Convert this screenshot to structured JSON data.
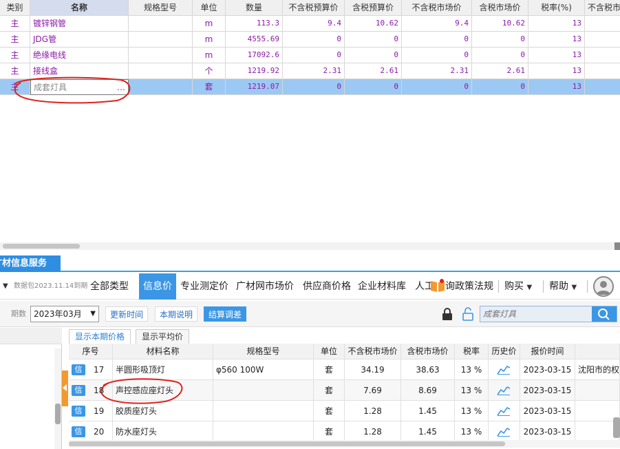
{
  "top_grid": {
    "columns": [
      {
        "key": "cat",
        "label": "类别",
        "width": 44,
        "active": false
      },
      {
        "key": "name",
        "label": "名称",
        "width": 143,
        "active": true
      },
      {
        "key": "spec",
        "label": "规格型号",
        "width": 93,
        "active": false
      },
      {
        "key": "unit",
        "label": "单位",
        "width": 48,
        "active": false
      },
      {
        "key": "qty",
        "label": "数量",
        "width": 83,
        "active": false
      },
      {
        "key": "p1",
        "label": "不含税预算价",
        "width": 90,
        "active": false
      },
      {
        "key": "p2",
        "label": "含税预算价",
        "width": 83,
        "active": false
      },
      {
        "key": "p3",
        "label": "不含税市场价",
        "width": 102,
        "active": false
      },
      {
        "key": "p4",
        "label": "含税市场价",
        "width": 82,
        "active": false
      },
      {
        "key": "tax",
        "label": "税率(%)",
        "width": 82,
        "active": false
      },
      {
        "key": "p5",
        "label": "不含税市",
        "width": 55,
        "active": false
      }
    ],
    "rows": [
      {
        "cat": "主",
        "name": "镀锌钢管",
        "spec": "",
        "unit": "m",
        "qty": "113.3",
        "p1": "9.4",
        "p2": "10.62",
        "p3": "9.4",
        "p4": "10.62",
        "tax": "13",
        "p5": ""
      },
      {
        "cat": "主",
        "name": "JDG管",
        "spec": "",
        "unit": "m",
        "qty": "4555.69",
        "p1": "0",
        "p2": "0",
        "p3": "0",
        "p4": "0",
        "tax": "13",
        "p5": ""
      },
      {
        "cat": "主",
        "name": "绝缘电线",
        "spec": "",
        "unit": "m",
        "qty": "17092.6",
        "p1": "0",
        "p2": "0",
        "p3": "0",
        "p4": "0",
        "tax": "13",
        "p5": ""
      },
      {
        "cat": "主",
        "name": "接线盒",
        "spec": "",
        "unit": "个",
        "qty": "1219.92",
        "p1": "2.31",
        "p2": "2.61",
        "p3": "2.31",
        "p4": "2.61",
        "tax": "13",
        "p5": ""
      },
      {
        "cat": "主",
        "name": "成套灯具",
        "spec": "",
        "unit": "套",
        "qty": "1219.07",
        "p1": "0",
        "p2": "0",
        "p3": "0",
        "p4": "0",
        "tax": "13",
        "p5": "",
        "selected": true
      }
    ],
    "ellipsis": "…"
  },
  "panel": {
    "tab_label": "广材信息服务",
    "package_label": "数据包2023.11.14到期",
    "menu": [
      {
        "label": "全部类型",
        "active": false
      },
      {
        "label": "信息价",
        "active": true
      },
      {
        "label": "专业测定价",
        "active": false
      },
      {
        "label": "广材网市场价",
        "active": false
      },
      {
        "label": "供应商价格",
        "active": false
      },
      {
        "label": "企业材料库",
        "active": false
      },
      {
        "label": "人工",
        "active": false
      },
      {
        "label": "询政策法规",
        "active": false
      }
    ],
    "buy_label": "购买",
    "help_label": "帮助",
    "caret": "▼"
  },
  "filter_bar": {
    "period_label": "期数",
    "period_value": "2023年03月",
    "update_time_label": "更新时间",
    "period_desc_label": "本期说明",
    "settle_label": "结算调差",
    "search_placeholder": "成套灯具"
  },
  "price_tabs": [
    {
      "label": "显示本期价格",
      "active": true
    },
    {
      "label": "显示平均价",
      "active": false
    }
  ],
  "price_table": {
    "columns": [
      {
        "label": "序号",
        "width": 64
      },
      {
        "label": "材料名称",
        "width": 146
      },
      {
        "label": "规格型号",
        "width": 146
      },
      {
        "label": "单位",
        "width": 45
      },
      {
        "label": "不含税市场价",
        "width": 82
      },
      {
        "label": "含税市场价",
        "width": 78
      },
      {
        "label": "税率",
        "width": 49
      },
      {
        "label": "历史价",
        "width": 46
      },
      {
        "label": "报价时间",
        "width": 80
      },
      {
        "label": "",
        "width": 65
      }
    ],
    "badge": "信",
    "rows": [
      {
        "seq": "17",
        "name": "半圆形吸顶灯",
        "spec": "φ560 100W",
        "unit": "套",
        "p_ex": "34.19",
        "p_in": "38.63",
        "tax": "13 %",
        "date": "2023-03-15",
        "region": "沈阳市的权"
      },
      {
        "seq": "18",
        "name": "声控感应座灯头",
        "spec": "",
        "unit": "套",
        "p_ex": "7.69",
        "p_in": "8.69",
        "tax": "13 %",
        "date": "2023-03-15",
        "region": ""
      },
      {
        "seq": "19",
        "name": "胶质座灯头",
        "spec": "",
        "unit": "套",
        "p_ex": "1.28",
        "p_in": "1.45",
        "tax": "13 %",
        "date": "2023-03-15",
        "region": ""
      },
      {
        "seq": "20",
        "name": "防水座灯头",
        "spec": "",
        "unit": "套",
        "p_ex": "1.28",
        "p_in": "1.45",
        "tax": "13 %",
        "date": "2023-03-15",
        "region": ""
      }
    ]
  },
  "colors": {
    "accent": "#3b97e5",
    "selected_row": "#9cc9f3",
    "text_purple": "#8b1aa8",
    "annotation_red": "#e0201c",
    "handle_orange": "#f39a2f"
  },
  "icons": [
    "lock-icon",
    "unlock-icon",
    "search-icon",
    "book-icon",
    "avatar-icon",
    "trend-chart-icon",
    "caret-down-icon"
  ]
}
